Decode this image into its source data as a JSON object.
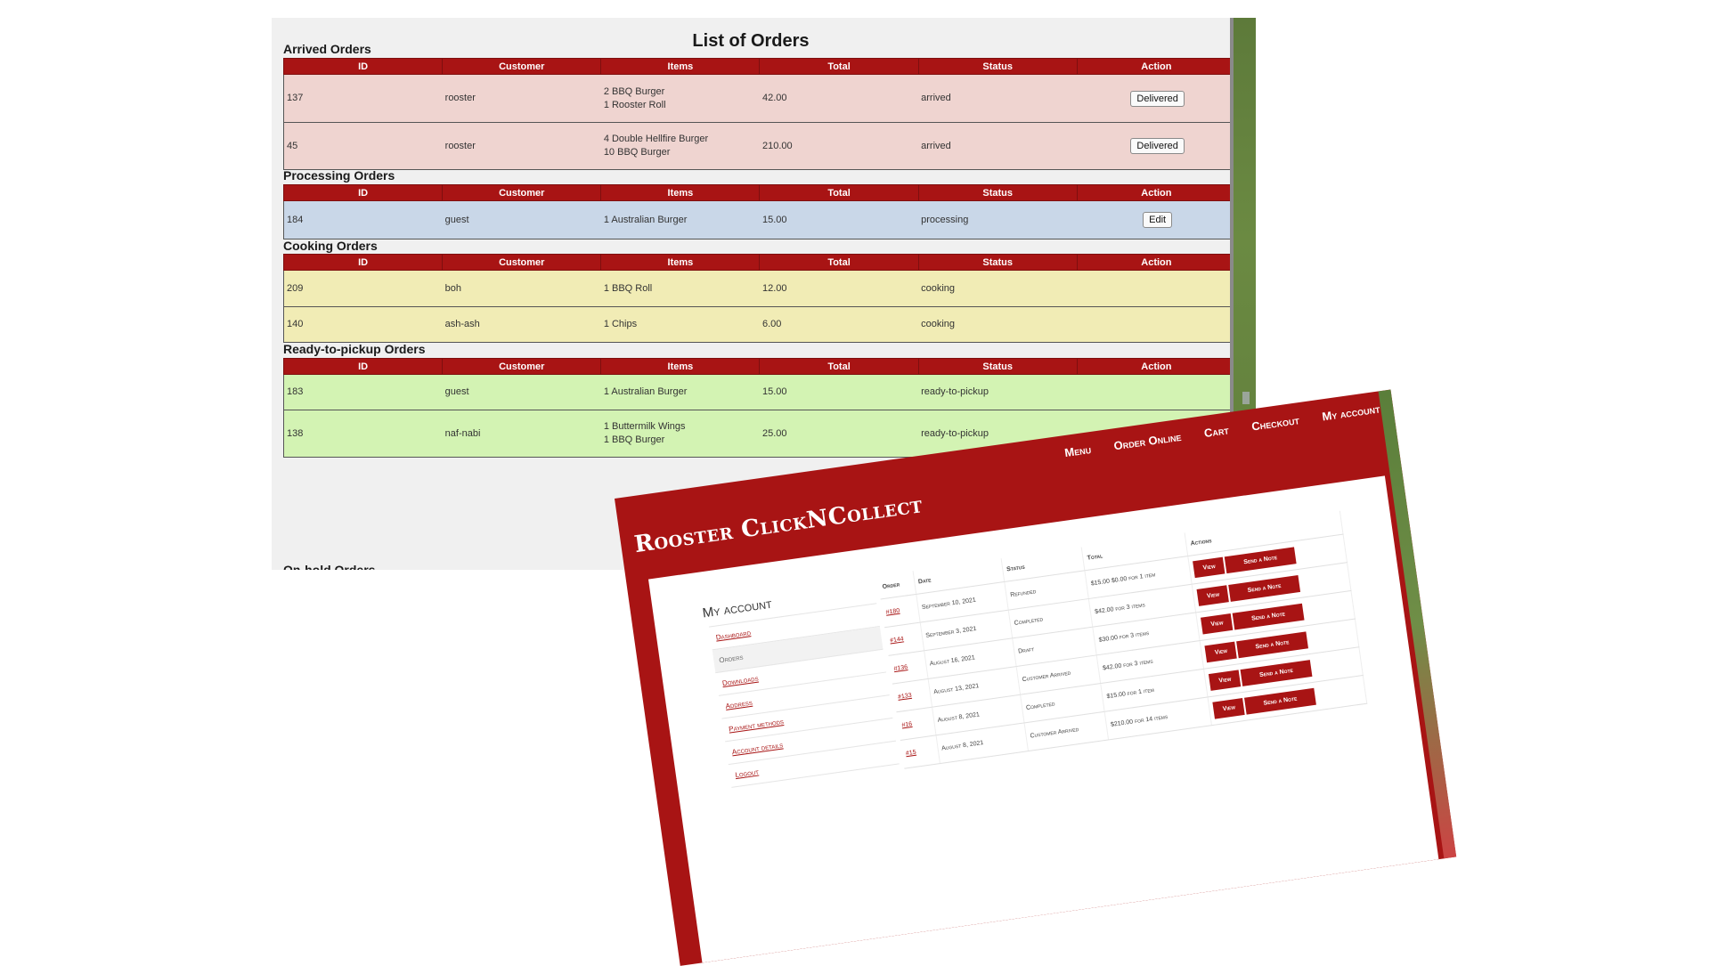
{
  "orders_admin": {
    "title": "List of Orders",
    "columns": [
      "ID",
      "Customer",
      "Items",
      "Total",
      "Status",
      "Action"
    ],
    "sections": [
      {
        "title": "Arrived Orders",
        "rows": [
          {
            "id": "137",
            "customer": "rooster",
            "items": [
              "2 BBQ Burger",
              "1 Rooster Roll"
            ],
            "total": "42.00",
            "status": "arrived",
            "action": "Delivered"
          },
          {
            "id": "45",
            "customer": "rooster",
            "items": [
              "4 Double Hellfire Burger",
              "10 BBQ Burger"
            ],
            "total": "210.00",
            "status": "arrived",
            "action": "Delivered"
          }
        ]
      },
      {
        "title": "Processing Orders",
        "rows": [
          {
            "id": "184",
            "customer": "guest",
            "items": [
              "1 Australian Burger"
            ],
            "total": "15.00",
            "status": "processing",
            "action": "Edit"
          }
        ]
      },
      {
        "title": "Cooking Orders",
        "rows": [
          {
            "id": "209",
            "customer": "boh",
            "items": [
              "1 BBQ Roll"
            ],
            "total": "12.00",
            "status": "cooking",
            "action": ""
          },
          {
            "id": "140",
            "customer": "ash-ash",
            "items": [
              "1 Chips"
            ],
            "total": "6.00",
            "status": "cooking",
            "action": ""
          }
        ]
      },
      {
        "title": "Ready-to-pickup Orders",
        "rows": [
          {
            "id": "183",
            "customer": "guest",
            "items": [
              "1 Australian Burger"
            ],
            "total": "15.00",
            "status": "ready-to-pickup",
            "action": ""
          },
          {
            "id": "138",
            "customer": "naf-nabi",
            "items": [
              "1 Buttermilk Wings",
              "1 BBQ Burger"
            ],
            "total": "25.00",
            "status": "ready-to-pickup",
            "action": ""
          }
        ]
      }
    ],
    "next_section_title": "On-hold Orders",
    "colors": {
      "header": "#a81414",
      "arrived": "#efd4d0",
      "processing": "#c9d7e8",
      "cooking": "#f1ecb5",
      "ready": "#d3f3b3"
    }
  },
  "store": {
    "brand": "Rooster ClickNCollect",
    "nav": [
      "Menu",
      "Order Online",
      "Cart",
      "Checkout",
      "My account"
    ],
    "account_title": "My account",
    "account_nav": [
      "Dashboard",
      "Orders",
      "Downloads",
      "Address",
      "Payment methods",
      "Account details",
      "Logout"
    ],
    "account_nav_active": "Orders",
    "table_columns": [
      "Order",
      "Date",
      "Status",
      "Total",
      "Actions"
    ],
    "orders": [
      {
        "order": "#180",
        "date": "September 10, 2021",
        "status": "Refunded",
        "total": "$15.00 $0.00 for 1 item"
      },
      {
        "order": "#144",
        "date": "September 3, 2021",
        "status": "Completed",
        "total": "$42.00 for 3 items"
      },
      {
        "order": "#136",
        "date": "August 16, 2021",
        "status": "Draft",
        "total": "$30.00 for 3 items"
      },
      {
        "order": "#133",
        "date": "August 13, 2021",
        "status": "Customer Arrived",
        "total": "$42.00 for 3 items"
      },
      {
        "order": "#16",
        "date": "August 8, 2021",
        "status": "Completed",
        "total": "$15.00 for 1 item"
      },
      {
        "order": "#15",
        "date": "August 8, 2021",
        "status": "Customer Arrived",
        "total": "$210.00 for 14 items"
      }
    ],
    "btn_view": "View",
    "btn_note": "Send a Note",
    "accent": "#a81414"
  }
}
